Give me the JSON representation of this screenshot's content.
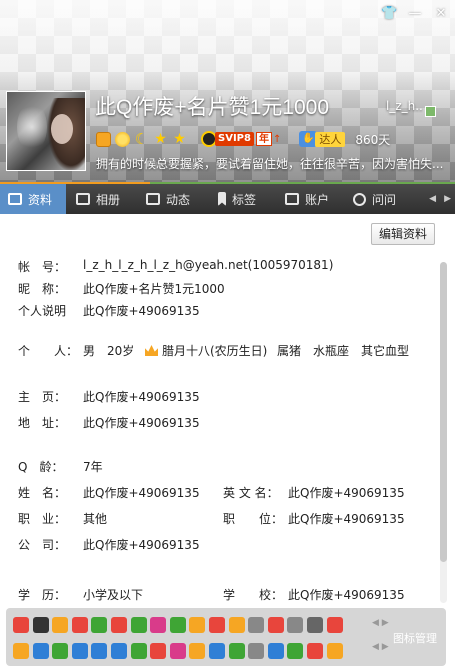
{
  "window": {
    "buttons": [
      {
        "name": "skin-button",
        "glyph": "👕"
      },
      {
        "name": "minimize-button",
        "glyph": "—"
      },
      {
        "name": "close-button",
        "glyph": "✕"
      }
    ]
  },
  "profile": {
    "nickname": "此Q作废+名片赞1元1000",
    "nickname_short": "l_z_h..",
    "signature": "拥有的时候总要握紧，要试着留住她，往往很辛苦，因为害怕失...",
    "talent_label": "达人",
    "days": "860天",
    "svip_label": "SVIP8",
    "year_label": "年",
    "level_icons": [
      "crown-icon",
      "sun-icon",
      "moon-icon",
      "star-icon",
      "star-icon"
    ]
  },
  "tabs": [
    {
      "label": "资料",
      "icon": "profile-card-icon",
      "active": true
    },
    {
      "label": "相册",
      "icon": "photo-album-icon",
      "active": false
    },
    {
      "label": "动态",
      "icon": "feed-list-icon",
      "active": false
    },
    {
      "label": "标签",
      "icon": "bookmark-tag-icon",
      "active": false
    },
    {
      "label": "账户",
      "icon": "wallet-icon",
      "active": false
    },
    {
      "label": "问问",
      "icon": "question-icon",
      "active": false
    }
  ],
  "edit_button": "编辑资料",
  "info": {
    "account_label": "帐　号：",
    "account_value": "l_z_h_l_z_h_l_z_h@yeah.net(1005970181)",
    "nick_label": "昵　称：",
    "nick_value": "此Q作废+名片赞1元1000",
    "desc_label": "个人说明",
    "desc_value": "此Q作废+49069135",
    "personal_label": "个　　人：",
    "gender": "男",
    "age": "20岁",
    "birthday": "腊月十八(农历生日)",
    "zodiac": "属猪",
    "constellation": "水瓶座",
    "blood": "其它血型",
    "homepage_label": "主　页：",
    "homepage_value": "此Q作废+49069135",
    "address_label": "地　址：",
    "address_value": "此Q作废+49069135",
    "qage_label": "Q　龄：",
    "qage_value": "7年",
    "name_label": "姓　名：",
    "name_value": "此Q作废+49069135",
    "ename_label": "英 文 名：",
    "ename_value": "此Q作废+49069135",
    "job_label": "职　业：",
    "job_value": "其他",
    "position_label": "职　　位：",
    "position_value": "此Q作废+49069135",
    "company_label": "公　司：",
    "company_value": "此Q作废+49069135",
    "edu_label": "学　历：",
    "edu_value": "小学及以下",
    "school_label": "学　　校：",
    "school_value": "此Q作废+49069135"
  },
  "icon_bar": {
    "manage_label": "图标管理",
    "colors": [
      "#e8453c",
      "#333333",
      "#f6a623",
      "#e8453c",
      "#3fa535",
      "#e8453c",
      "#3fa535",
      "#d93b8a",
      "#3fa535",
      "#f6a623",
      "#e8453c",
      "#f6a623",
      "#888888",
      "#e8453c",
      "#888888",
      "#666666",
      "#e8453c",
      "#f6a623",
      "#2f7fd6",
      "#3fa535",
      "#2f7fd6",
      "#2f7fd6",
      "#2f7fd6",
      "#3fa535",
      "#e8453c",
      "#d93b8a",
      "#f6a623",
      "#2f7fd6",
      "#3fa535",
      "#888888",
      "#2f7fd6",
      "#3fa535",
      "#e8453c",
      "#f6a623"
    ]
  }
}
